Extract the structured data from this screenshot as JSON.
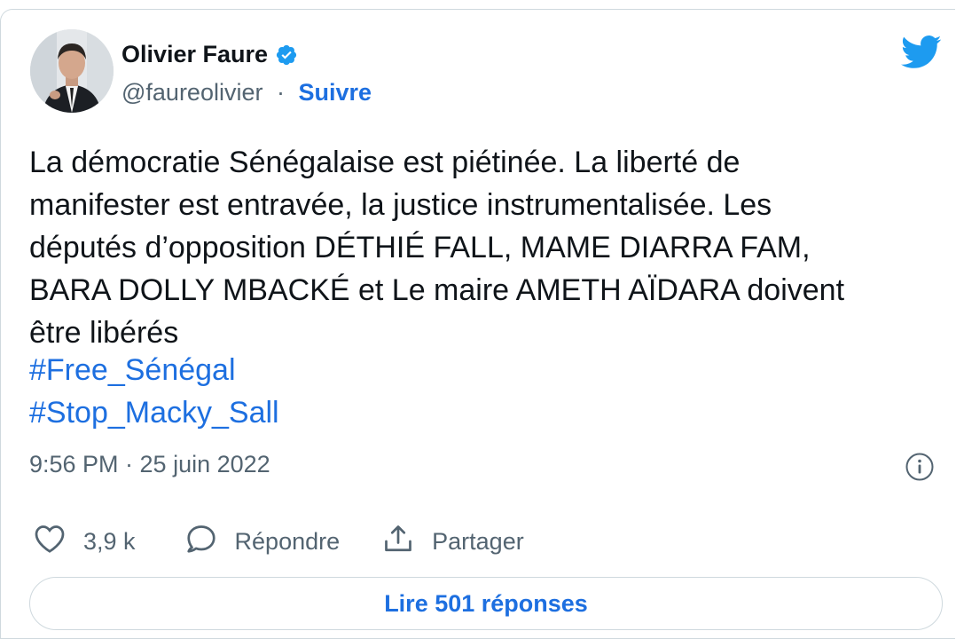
{
  "author": {
    "name": "Olivier Faure",
    "handle": "@faureolivier",
    "separator": "·",
    "follow_label": "Suivre"
  },
  "tweet": {
    "text": "La démocratie Sénégalaise est piétinée. La liberté de\nmanifester est entravée, la justice instrumentalisée. Les\ndéputés d’opposition DÉTHIÉ FALL, MAME DIARRA FAM,\nBARA DOLLY MBACKÉ et Le maire AMETH AÏDARA doivent\nêtre libérés",
    "hashtags": [
      "#Free_Sénégal",
      "#Stop_Macky_Sall"
    ],
    "time": "9:56 PM · 25 juin 2022"
  },
  "actions": {
    "like_count": "3,9 k",
    "reply_label": "Répondre",
    "share_label": "Partager"
  },
  "replies_button": "Lire 501 réponses",
  "colors": {
    "accent": "#1d6fe0",
    "text": "#0f1419",
    "secondary": "#536471",
    "border": "#cfd9de",
    "twitter_blue": "#1d9bf0"
  },
  "icons": [
    "verified-badge-icon",
    "twitter-bird-icon",
    "info-icon",
    "heart-icon",
    "reply-bubble-icon",
    "share-icon"
  ]
}
